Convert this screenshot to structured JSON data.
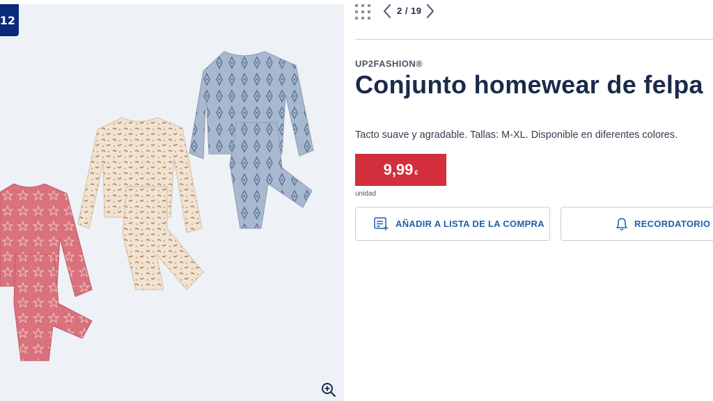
{
  "gallery": {
    "badge": "12",
    "counter": "2 / 19",
    "image_alt": "Tres conjuntos de pijama de felpa: rosa con estrellas, beige con estampado de leopardo y azul con estampado geométrico"
  },
  "product": {
    "brand": "UP2FASHION®",
    "title": "Conjunto homewear de felpa",
    "description": "Tacto suave y agradable. Tallas: M-XL. Disponible en diferentes colores.",
    "price": "9,99",
    "currency": "€",
    "unit": "unidad"
  },
  "actions": {
    "add_to_list": "AÑADIR A LISTA DE LA COMPRA",
    "reminder": "RECORDATORIO"
  },
  "colors": {
    "navy": "#0a2a7a",
    "price_red": "#d22e3c",
    "link_blue": "#1f5fa8",
    "panel_bg": "#eef1f6"
  },
  "icons": [
    "grid-icon",
    "chevron-left-icon",
    "chevron-right-icon",
    "zoom-in-icon",
    "list-add-icon",
    "bell-icon"
  ]
}
